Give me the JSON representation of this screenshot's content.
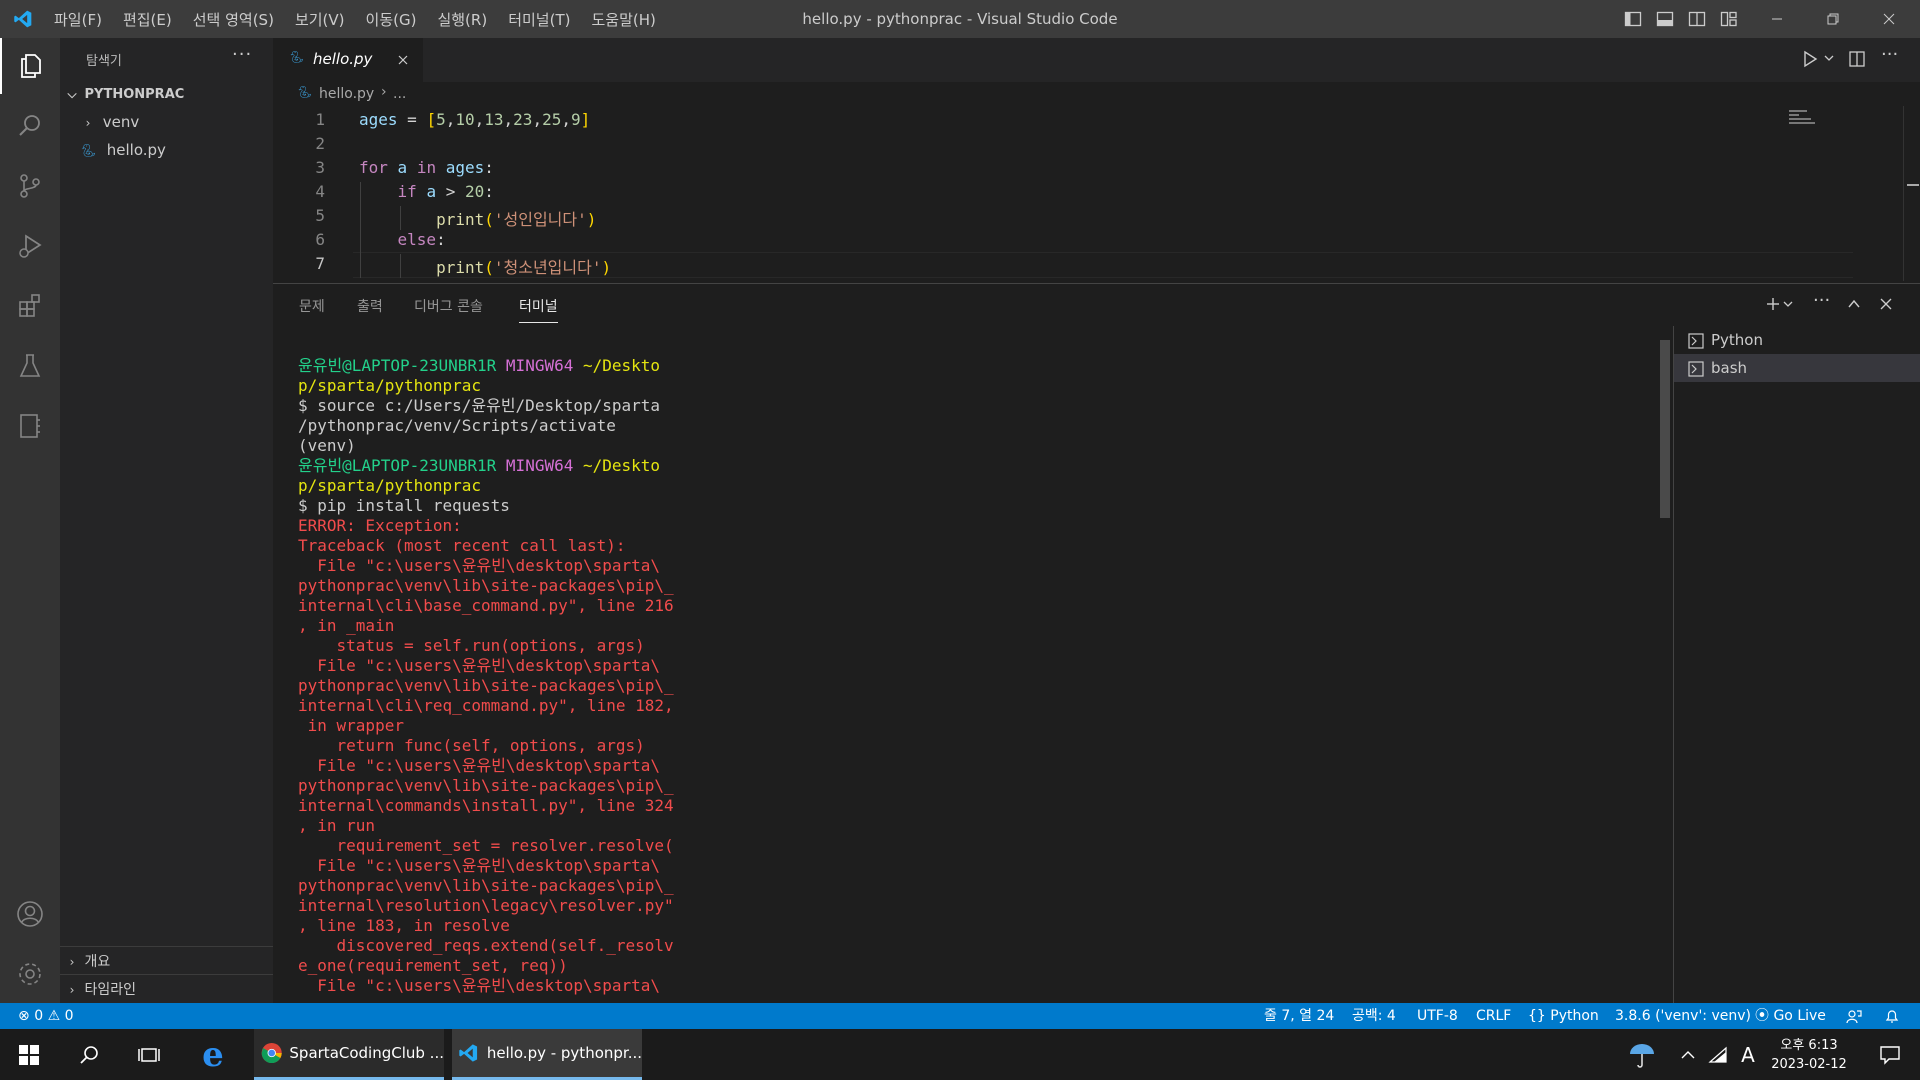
{
  "titlebar": {
    "menu": [
      "파일(F)",
      "편집(E)",
      "선택 영역(S)",
      "보기(V)",
      "이동(G)",
      "실행(R)",
      "터미널(T)",
      "도움말(H)"
    ],
    "title": "hello.py - pythonprac - Visual Studio Code"
  },
  "sidebar": {
    "title": "탐색기",
    "more": "···",
    "folder": "PYTHONPRAC",
    "items": [
      {
        "label": "venv",
        "type": "folder"
      },
      {
        "label": "hello.py",
        "type": "python-file"
      }
    ],
    "outline": "개요",
    "timeline": "타임라인"
  },
  "editor": {
    "tab": "hello.py",
    "breadcrumb": {
      "file": "hello.py",
      "rest": "..."
    },
    "line_numbers": [
      "1",
      "2",
      "3",
      "4",
      "5",
      "6",
      "7"
    ],
    "lines": [
      "ages = [5,10,13,23,25,9]",
      "",
      "for a in ages:",
      "    if a > 20:",
      "        print('성인입니다')",
      "    else:",
      "        print('청소년입니다')"
    ]
  },
  "panel": {
    "tabs": [
      "문제",
      "출력",
      "디버그 콘솔",
      "터미널"
    ],
    "active_tab": "터미널",
    "terminals": [
      "Python",
      "bash"
    ],
    "terminal_lines": [
      [
        {
          "c": "g",
          "t": "윤유빈@LAPTOP-23UNBR1R "
        },
        {
          "c": "m",
          "t": "MINGW64 "
        },
        {
          "c": "y",
          "t": "~/Deskto"
        }
      ],
      [
        {
          "c": "y",
          "t": "p/sparta/pythonprac"
        }
      ],
      [
        {
          "c": "w",
          "t": "$ source c:/Users/윤유빈/Desktop/sparta"
        }
      ],
      [
        {
          "c": "w",
          "t": "/pythonprac/venv/Scripts/activate"
        }
      ],
      [
        {
          "c": "w",
          "t": "(venv)"
        }
      ],
      [
        {
          "c": "g",
          "t": "윤유빈@LAPTOP-23UNBR1R "
        },
        {
          "c": "m",
          "t": "MINGW64 "
        },
        {
          "c": "y",
          "t": "~/Deskto"
        }
      ],
      [
        {
          "c": "y",
          "t": "p/sparta/pythonprac"
        }
      ],
      [
        {
          "c": "w",
          "t": "$ pip install requests"
        }
      ],
      [
        {
          "c": "r",
          "t": "ERROR: Exception:"
        }
      ],
      [
        {
          "c": "r",
          "t": "Traceback (most recent call last):"
        }
      ],
      [
        {
          "c": "r",
          "t": "  File \"c:\\users\\윤유빈\\desktop\\sparta\\"
        }
      ],
      [
        {
          "c": "r",
          "t": "pythonprac\\venv\\lib\\site-packages\\pip\\_"
        }
      ],
      [
        {
          "c": "r",
          "t": "internal\\cli\\base_command.py\", line 216"
        }
      ],
      [
        {
          "c": "r",
          "t": ", in _main"
        }
      ],
      [
        {
          "c": "r",
          "t": "    status = self.run(options, args)"
        }
      ],
      [
        {
          "c": "r",
          "t": "  File \"c:\\users\\윤유빈\\desktop\\sparta\\"
        }
      ],
      [
        {
          "c": "r",
          "t": "pythonprac\\venv\\lib\\site-packages\\pip\\_"
        }
      ],
      [
        {
          "c": "r",
          "t": "internal\\cli\\req_command.py\", line 182,"
        }
      ],
      [
        {
          "c": "r",
          "t": " in wrapper"
        }
      ],
      [
        {
          "c": "r",
          "t": "    return func(self, options, args)"
        }
      ],
      [
        {
          "c": "r",
          "t": "  File \"c:\\users\\윤유빈\\desktop\\sparta\\"
        }
      ],
      [
        {
          "c": "r",
          "t": "pythonprac\\venv\\lib\\site-packages\\pip\\_"
        }
      ],
      [
        {
          "c": "r",
          "t": "internal\\commands\\install.py\", line 324"
        }
      ],
      [
        {
          "c": "r",
          "t": ", in run"
        }
      ],
      [
        {
          "c": "r",
          "t": "    requirement_set = resolver.resolve("
        }
      ],
      [
        {
          "c": "r",
          "t": "  File \"c:\\users\\윤유빈\\desktop\\sparta\\"
        }
      ],
      [
        {
          "c": "r",
          "t": "pythonprac\\venv\\lib\\site-packages\\pip\\_"
        }
      ],
      [
        {
          "c": "r",
          "t": "internal\\resolution\\legacy\\resolver.py\""
        }
      ],
      [
        {
          "c": "r",
          "t": ", line 183, in resolve"
        }
      ],
      [
        {
          "c": "r",
          "t": "    discovered_reqs.extend(self._resolv"
        }
      ],
      [
        {
          "c": "r",
          "t": "e_one(requirement_set, req))"
        }
      ],
      [
        {
          "c": "r",
          "t": "  File \"c:\\users\\윤유빈\\desktop\\sparta\\"
        }
      ]
    ]
  },
  "statusbar": {
    "errors": "0",
    "warnings": "0",
    "position": "줄 7, 열 24",
    "spaces": "공백: 4",
    "encoding": "UTF-8",
    "eol": "CRLF",
    "language": "Python",
    "interpreter": "3.8.6 ('venv': venv)",
    "golive": "Go Live"
  },
  "taskbar": {
    "chrome_label": "SpartaCodingClub ...",
    "vscode_label": "hello.py - pythonpr...",
    "ime": "A",
    "time": "오후 6:13",
    "date": "2023-02-12"
  },
  "colors": {
    "accent": "#007acc",
    "titlebar": "#3c3c3c",
    "activitybar": "#333333",
    "sidebar": "#252526",
    "editor": "#1e1e1e"
  }
}
